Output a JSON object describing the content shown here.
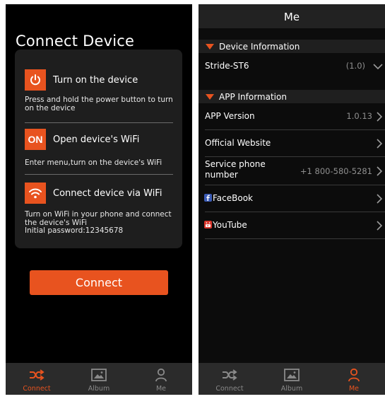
{
  "connect_screen": {
    "title": "Connect Device",
    "steps": [
      {
        "icon": "power-icon",
        "title": "Turn on the device",
        "description": "Press and hold the power button to turn on the device"
      },
      {
        "icon_text": "ON",
        "title": "Open device's WiFi",
        "description": "Enter menu,turn on the device's WiFi"
      },
      {
        "icon": "wifi-icon",
        "title": "Connect device via WiFi",
        "description": "Turn on WiFi in your phone and connect the device's WiFi\nInitial password:12345678"
      }
    ],
    "connect_button": "Connect"
  },
  "me_screen": {
    "title": "Me",
    "device_section": "Device Information",
    "device": {
      "name": "Stride-ST6",
      "version": "(1.0)"
    },
    "app_section": "APP Information",
    "rows": [
      {
        "label": "APP Version",
        "value": "1.0.13"
      },
      {
        "label": "Official Website",
        "value": ""
      },
      {
        "label": "Service phone number",
        "value": "+1 800-580-5281"
      },
      {
        "label": "FaceBook",
        "value": ""
      },
      {
        "label": "YouTube",
        "value": ""
      }
    ]
  },
  "tabbar": {
    "tabs": [
      {
        "label": "Connect",
        "icon": "shuffle-icon"
      },
      {
        "label": "Album",
        "icon": "image-icon"
      },
      {
        "label": "Me",
        "icon": "person-icon"
      }
    ],
    "left_active": "Connect",
    "right_active": "Me"
  },
  "colors": {
    "accent": "#e8531f",
    "background": "#000000",
    "card": "#1e1e1e",
    "tabbar": "#2b2b2b",
    "muted_text": "#8f8f8f",
    "facebook": "#3b5bb5",
    "youtube": "#d9362c"
  }
}
